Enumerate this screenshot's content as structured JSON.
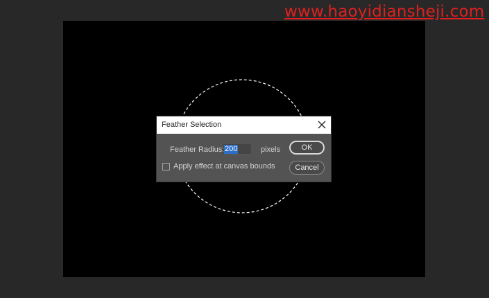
{
  "watermark": {
    "text": "www.haoyidiansheji.com"
  },
  "dialog": {
    "title": "Feather Selection",
    "feather_radius_label": "Feather Radius:",
    "feather_radius_value": "200",
    "unit_label": "pixels",
    "checkbox_label": "Apply effect at canvas bounds",
    "checkbox_checked": false,
    "ok_label": "OK",
    "cancel_label": "Cancel"
  },
  "colors": {
    "workspace_bg": "#282828",
    "canvas_bg": "#000000",
    "dialog_bg": "#535353",
    "watermark": "#e02020",
    "input_highlight": "#2f6ec5"
  },
  "icons": {
    "close": "close-icon"
  }
}
